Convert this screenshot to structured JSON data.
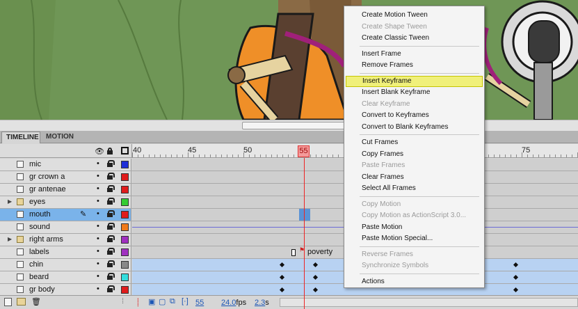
{
  "tabs": [
    {
      "label": "TIMELINE"
    },
    {
      "label": "MOTION EDITOR"
    }
  ],
  "ruler": {
    "numbers": [
      "40",
      "45",
      "50",
      "55",
      "75"
    ],
    "current": "55"
  },
  "layers": [
    {
      "name": "mic",
      "type": "layer",
      "color": "#1f2fd8"
    },
    {
      "name": "gr crown a",
      "type": "layer",
      "color": "#e01c1c"
    },
    {
      "name": "gr antenae",
      "type": "layer",
      "color": "#e01c1c"
    },
    {
      "name": "eyes",
      "type": "folder",
      "color": "#33cc33"
    },
    {
      "name": "mouth",
      "type": "layer",
      "color": "#e01c1c",
      "selected": true
    },
    {
      "name": "sound",
      "type": "layer",
      "color": "#f07a1a"
    },
    {
      "name": "right arms",
      "type": "folder",
      "color": "#a030c0"
    },
    {
      "name": "labels",
      "type": "layer",
      "color": "#a030c0"
    },
    {
      "name": "chin",
      "type": "layer",
      "color": "#888888"
    },
    {
      "name": "beard",
      "type": "layer",
      "color": "#33dddd"
    },
    {
      "name": "gr body",
      "type": "layer",
      "color": "#e01c1c"
    }
  ],
  "frame_label": "poverty",
  "status": {
    "frame": "55",
    "fps_value": "24.0",
    "fps_unit": "fps",
    "time_value": "2.3",
    "time_unit": "s"
  },
  "context_menu": [
    {
      "label": "Create Motion Tween",
      "enabled": true
    },
    {
      "label": "Create Shape Tween",
      "enabled": false
    },
    {
      "label": "Create Classic Tween",
      "enabled": true
    },
    {
      "sep": true
    },
    {
      "label": "Insert Frame",
      "enabled": true
    },
    {
      "label": "Remove Frames",
      "enabled": true
    },
    {
      "sep": true
    },
    {
      "label": "Insert Keyframe",
      "enabled": true,
      "highlight": true
    },
    {
      "label": "Insert Blank Keyframe",
      "enabled": true
    },
    {
      "label": "Clear Keyframe",
      "enabled": false
    },
    {
      "label": "Convert to Keyframes",
      "enabled": true
    },
    {
      "label": "Convert to Blank Keyframes",
      "enabled": true
    },
    {
      "sep": true
    },
    {
      "label": "Cut Frames",
      "enabled": true
    },
    {
      "label": "Copy Frames",
      "enabled": true
    },
    {
      "label": "Paste Frames",
      "enabled": false
    },
    {
      "label": "Clear Frames",
      "enabled": true
    },
    {
      "label": "Select All Frames",
      "enabled": true
    },
    {
      "sep": true
    },
    {
      "label": "Copy Motion",
      "enabled": false
    },
    {
      "label": "Copy Motion as ActionScript 3.0...",
      "enabled": false
    },
    {
      "label": "Paste Motion",
      "enabled": true
    },
    {
      "label": "Paste Motion Special...",
      "enabled": true
    },
    {
      "sep": true
    },
    {
      "label": "Reverse Frames",
      "enabled": false
    },
    {
      "label": "Synchronize Symbols",
      "enabled": false
    },
    {
      "sep": true
    },
    {
      "label": "Actions",
      "enabled": true
    }
  ]
}
